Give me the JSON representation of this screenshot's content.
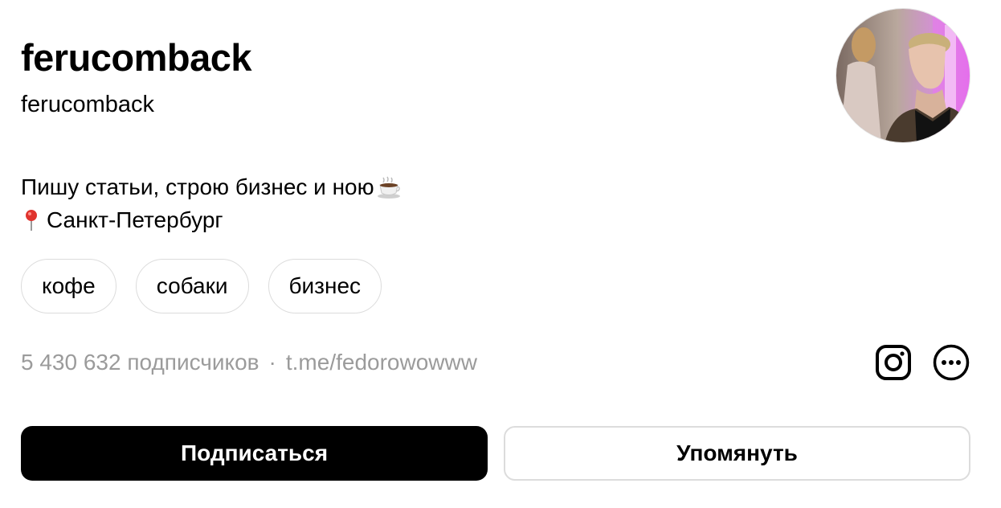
{
  "profile": {
    "display_name": "ferucomback",
    "username": "ferucomback",
    "bio_line1": "Пишу статьи, строю бизнес и ною",
    "bio_line1_emoji": "coffee-cup-icon",
    "bio_line2_emoji": "pin-icon",
    "bio_line2": "Санкт-Петербург",
    "tags": [
      {
        "label": "кофе"
      },
      {
        "label": "собаки"
      },
      {
        "label": "бизнес"
      }
    ],
    "followers": "5 430 632 подписчиков",
    "separator": "·",
    "link": "t.me/fedorowowww",
    "avatar_icon": "avatar"
  },
  "actions": {
    "subscribe_label": "Подписаться",
    "mention_label": "Упомянуть",
    "instagram_icon": "instagram-icon",
    "more_icon": "more-icon"
  },
  "colors": {
    "primary_button": "#000000",
    "muted_text": "#9b9b9b",
    "border": "#dcdcdc"
  }
}
